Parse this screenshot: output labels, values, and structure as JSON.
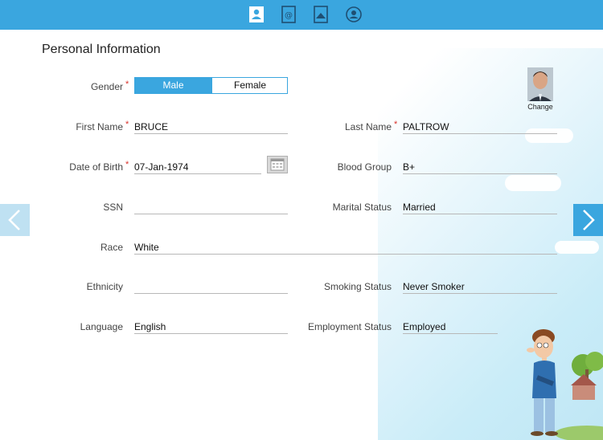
{
  "title": "Personal Information",
  "tabs": [
    {
      "name": "contact-card-icon"
    },
    {
      "name": "address-book-icon"
    },
    {
      "name": "family-icon"
    },
    {
      "name": "account-circle-icon"
    }
  ],
  "gender": {
    "label": "Gender",
    "options": [
      "Male",
      "Female"
    ],
    "selected": "Male"
  },
  "photo": {
    "change_label": "Change"
  },
  "fields": {
    "first_name": {
      "label": "First Name",
      "value": "BRUCE"
    },
    "last_name": {
      "label": "Last Name",
      "value": "PALTROW"
    },
    "dob": {
      "label": "Date of Birth",
      "value": "07-Jan-1974"
    },
    "blood_group": {
      "label": "Blood Group",
      "value": "B+"
    },
    "ssn": {
      "label": "SSN",
      "value": ""
    },
    "marital_status": {
      "label": "Marital Status",
      "value": "Married"
    },
    "race": {
      "label": "Race",
      "value": "White"
    },
    "ethnicity": {
      "label": "Ethnicity",
      "value": ""
    },
    "smoking_status": {
      "label": "Smoking Status",
      "value": "Never Smoker"
    },
    "language": {
      "label": "Language",
      "value": "English"
    },
    "employment_status": {
      "label": "Employment Status",
      "value": "Employed"
    }
  },
  "required_mark": "*",
  "colors": {
    "accent": "#3aa6df",
    "required": "#d9322b"
  }
}
